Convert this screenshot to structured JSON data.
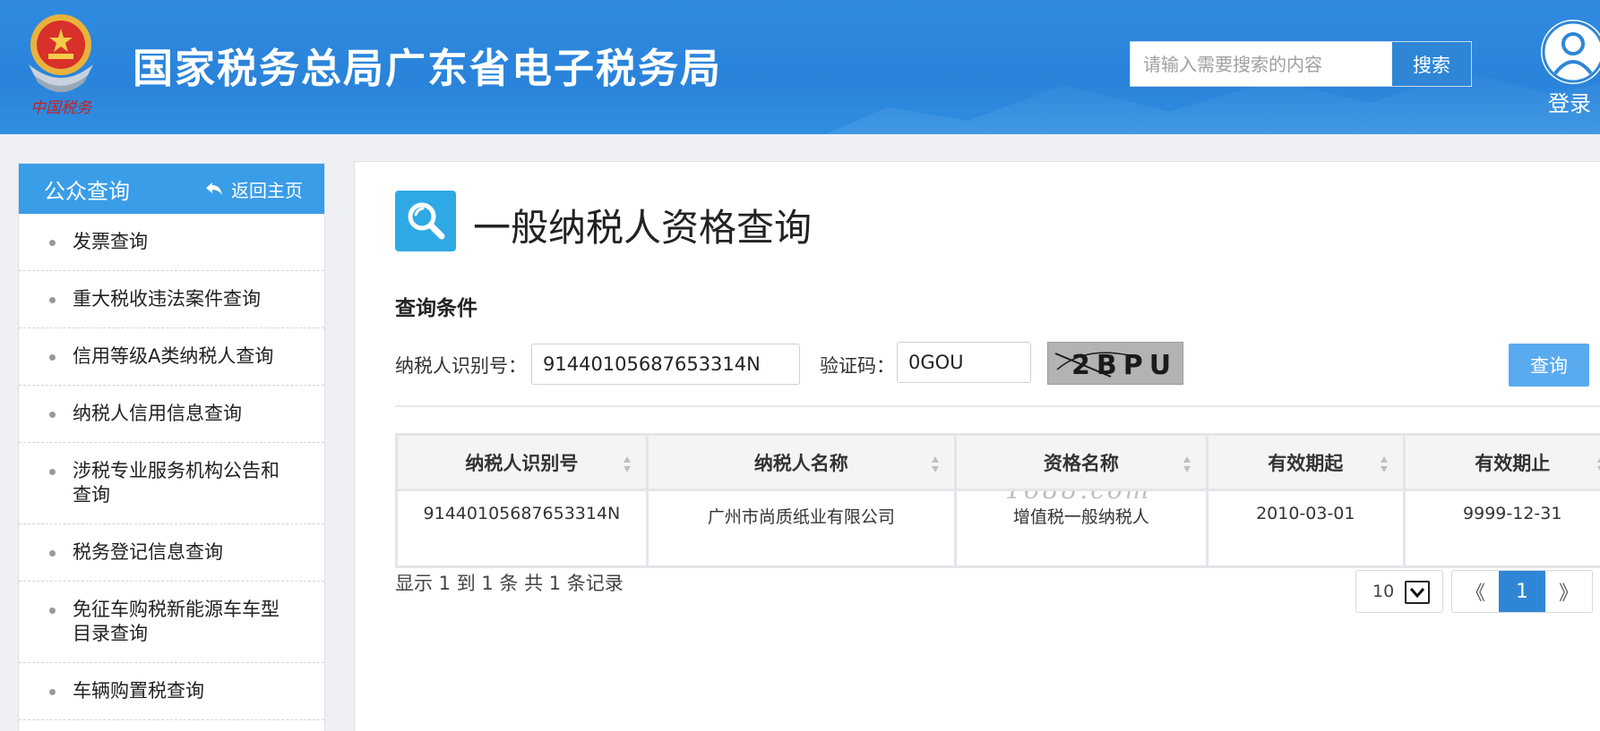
{
  "header": {
    "emblem_caption": "中国税务",
    "site_title": "国家税务总局广东省电子税务局",
    "search_placeholder": "请输入需要搜索的内容",
    "search_button": "搜索",
    "login_label": "登录"
  },
  "sidebar": {
    "title": "公众查询",
    "back_home": "返回主页",
    "items": [
      {
        "label": "发票查询"
      },
      {
        "label": "重大税收违法案件查询"
      },
      {
        "label": "信用等级A类纳税人查询"
      },
      {
        "label": "纳税人信用信息查询"
      },
      {
        "label": "涉税专业服务机构公告和查询"
      },
      {
        "label": "税务登记信息查询"
      },
      {
        "label": "免征车购税新能源车车型目录查询"
      },
      {
        "label": "车辆购置税查询"
      }
    ]
  },
  "main": {
    "page_title": "一般纳税人资格查询",
    "condition_label": "查询条件",
    "taxpayer_id_label": "纳税人识别号：",
    "taxpayer_id_value": "91440105687653314N",
    "captcha_label": "验证码：",
    "captcha_value": "0GOU",
    "captcha_image_text": "2BPU",
    "query_button": "查询",
    "watermark": "1688.com",
    "table": {
      "headers": [
        "纳税人识别号",
        "纳税人名称",
        "资格名称",
        "有效期起",
        "有效期止"
      ],
      "rows": [
        [
          "91440105687653314N",
          "广州市尚质纸业有限公司",
          "增值税一般纳税人",
          "2010-03-01",
          "9999-12-31"
        ]
      ]
    },
    "records_text": "显示 1 到 1 条 共 1 条记录",
    "page_size": "10",
    "pager": {
      "prev": "《",
      "current": "1",
      "next": "》"
    }
  },
  "colors": {
    "header_blue": "#2f8be0",
    "accent_blue": "#2f86d6",
    "sidebar_head": "#3a9de8",
    "query_button": "#5aaaf0",
    "icon_bg": "#2fa9e6"
  }
}
